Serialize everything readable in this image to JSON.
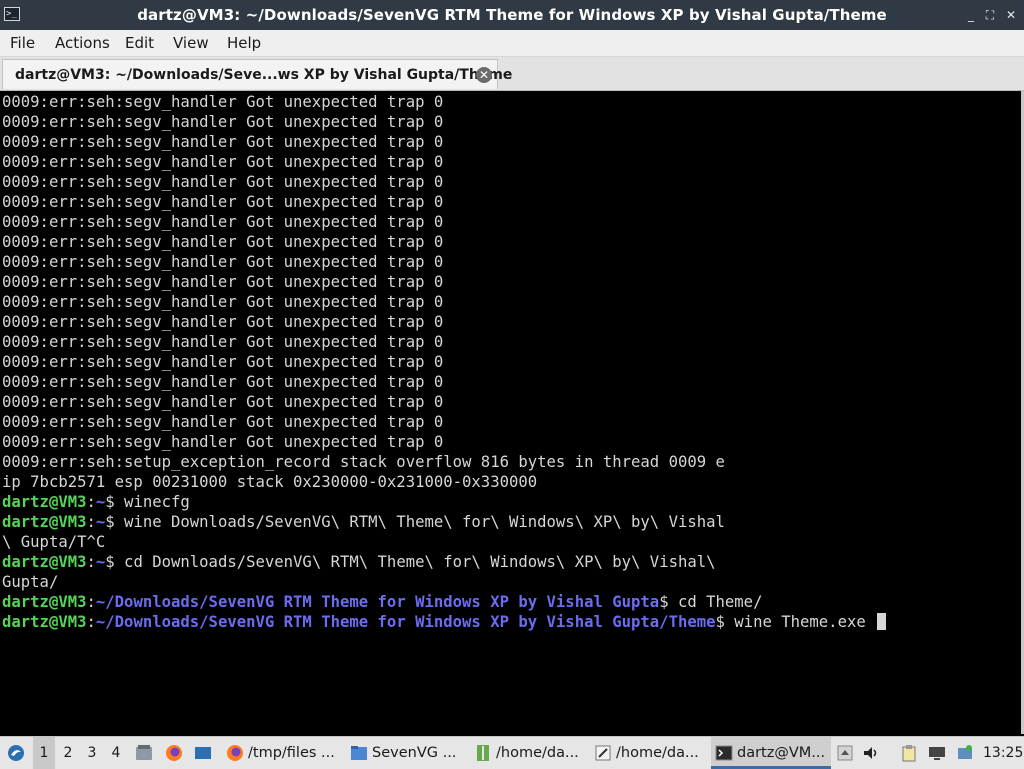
{
  "window": {
    "title": "dartz@VM3: ~/Downloads/SevenVG RTM Theme for Windows XP by Vishal Gupta/Theme",
    "app_icon_glyph": ">_",
    "controls": {
      "minimize": "_",
      "maximize": "⛶",
      "close": "✕"
    }
  },
  "menubar": [
    "File",
    "Actions",
    "Edit",
    "View",
    "Help"
  ],
  "tab": {
    "label": "dartz@VM3: ~/Downloads/Seve...ws XP by Vishal Gupta/Theme",
    "close": "✕"
  },
  "terminal": {
    "repeated_error": "0009:err:seh:segv_handler Got unexpected trap 0",
    "repeat_count": 18,
    "overflow_line1": "0009:err:seh:setup_exception_record stack overflow 816 bytes in thread 0009 e",
    "overflow_line2": "ip 7bcb2571 esp 00231000 stack 0x230000-0x231000-0x330000",
    "prompt_user": "dartz@VM3",
    "prompt_sep": ":",
    "home_path": "~",
    "dollar": "$",
    "cmd1": " winecfg",
    "cmd2": " wine Downloads/SevenVG\\ RTM\\ Theme\\ for\\ Windows\\ XP\\ by\\ Vishal",
    "cmd2_cont": "\\ Gupta/T^C",
    "cmd3": " cd Downloads/SevenVG\\ RTM\\ Theme\\ for\\ Windows\\ XP\\ by\\ Vishal\\",
    "cmd3_cont": "Gupta/",
    "path4": "~/Downloads/SevenVG RTM Theme for Windows XP by Vishal Gupta",
    "cmd4": " cd Theme/",
    "path5": "~/Downloads/SevenVG RTM Theme for Windows XP by Vishal Gupta/Theme",
    "cmd5": " wine Theme.exe "
  },
  "taskbar": {
    "workspaces": [
      "1",
      "2",
      "3",
      "4"
    ],
    "active_workspace": "1",
    "tasks": [
      {
        "label": "/tmp/files ...",
        "icon": "firefox-icon"
      },
      {
        "label": "SevenVG ...",
        "icon": "folder-icon"
      },
      {
        "label": "/home/da...",
        "icon": "archive-icon"
      },
      {
        "label": "/home/da...",
        "icon": "text-editor-icon"
      },
      {
        "label": "dartz@VM...",
        "icon": "terminal-icon"
      }
    ],
    "clock": "13:25"
  },
  "colors": {
    "prompt_user": "#55d455",
    "prompt_path": "#6c6cf0",
    "terminal_bg": "#000000",
    "terminal_fg": "#d6d6d6"
  }
}
